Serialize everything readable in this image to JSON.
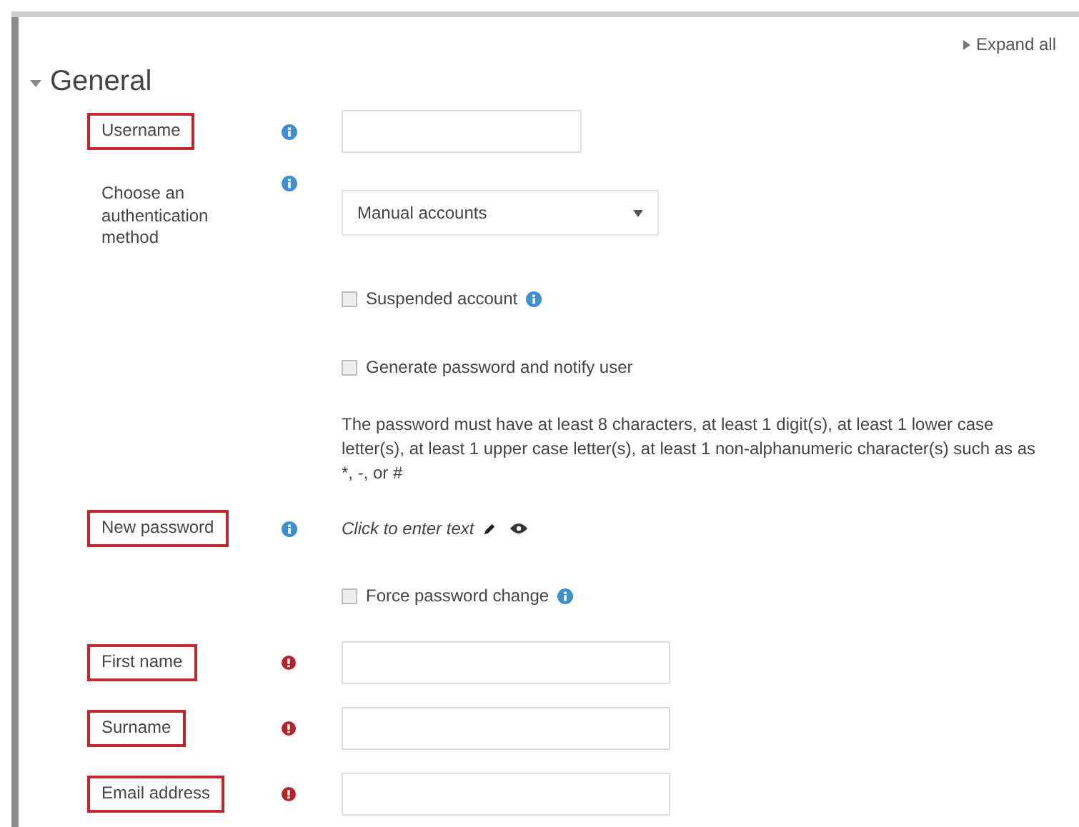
{
  "expand_all": "Expand all",
  "section": {
    "title": "General",
    "expanded": true
  },
  "rows": [
    {
      "kind": "text",
      "label": "Username",
      "highlighted": true,
      "required": false
    },
    {
      "kind": "select",
      "label": "Choose an authentication method",
      "highlighted": false,
      "required": false,
      "value": "Manual accounts"
    },
    {
      "kind": "checkbox",
      "text": "Suspended account",
      "checked": false,
      "help": true
    },
    {
      "kind": "checkbox",
      "text": "Generate password and notify user",
      "checked": false,
      "help": false
    },
    {
      "kind": "note",
      "text": "The password must have at least 8 characters, at least 1 digit(s), at least 1 lower case letter(s), at least 1 upper case letter(s), at least 1 non-alphanumeric character(s) such as as *, -, or #"
    },
    {
      "kind": "password",
      "label": "New password",
      "highlighted": true,
      "required": false,
      "text": "Click to enter text"
    },
    {
      "kind": "checkbox",
      "text": "Force password change",
      "checked": false,
      "help": true
    },
    {
      "kind": "text",
      "label": "First name",
      "highlighted": true,
      "required": true
    },
    {
      "kind": "text",
      "label": "Surname",
      "highlighted": true,
      "required": true
    },
    {
      "kind": "text",
      "label": "Email address",
      "highlighted": true,
      "required": true
    }
  ]
}
